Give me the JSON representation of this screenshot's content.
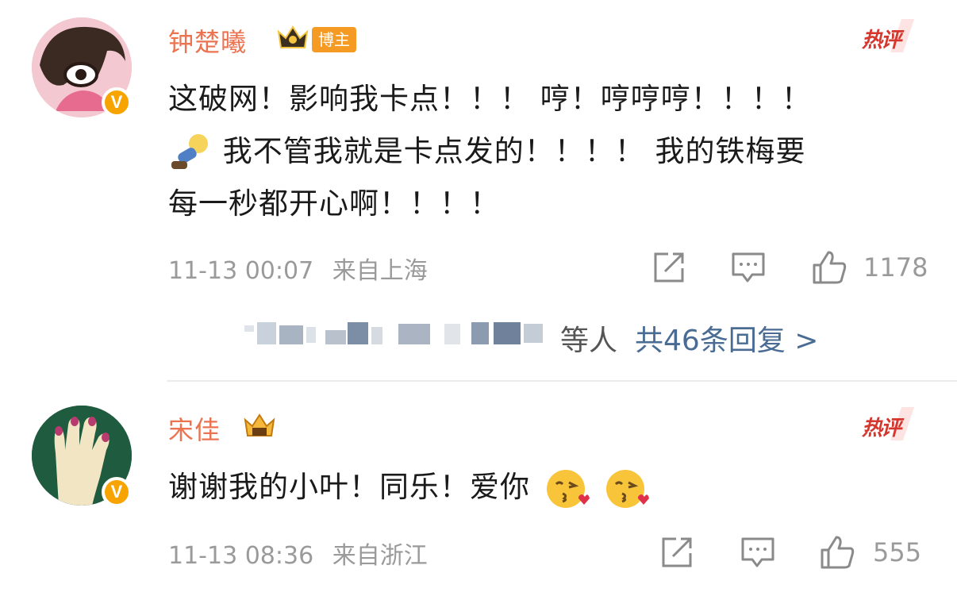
{
  "comments": [
    {
      "username": "钟楚曦",
      "tag": "博主",
      "hot_label": "热评",
      "verified": "V",
      "text_line1": "这破网！影响我卡点！！！ 哼！哼哼哼！！！！",
      "text_line2": "我不管我就是卡点发的！！！！ 我的铁梅要",
      "text_line3": "每一秒都开心啊！！！！",
      "timestamp": "11-13 00:07",
      "location": "来自上海",
      "likes": "1178",
      "reply_summary": "等人",
      "reply_link": "共46条回复 >"
    },
    {
      "username": "宋佳",
      "hot_label": "热评",
      "verified": "V",
      "text": "谢谢我的小叶！同乐！爱你",
      "timestamp": "11-13 08:36",
      "location": "来自浙江",
      "likes": "555"
    }
  ],
  "colors": {
    "username": "#eb7350",
    "hot": "#d5362d",
    "link": "#4a6b94",
    "meta": "#9a9a9a"
  },
  "icons": [
    "share-icon",
    "comment-icon",
    "thumbs-up-icon",
    "crown-icon",
    "kiss-emoji"
  ]
}
